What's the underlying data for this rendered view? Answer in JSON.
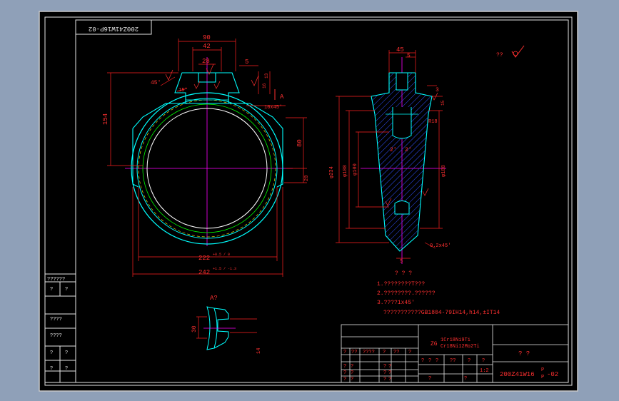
{
  "drawing": {
    "corner_code": "200Z41W16P-02",
    "code": "200Z41W16",
    "code_suffix": "-02",
    "code_p_upper": "P",
    "code_p_lower": "P",
    "roughness_note": "??",
    "section_label": "A",
    "detail_label": "A?",
    "material_line1": "ZG",
    "material_line2": "1Cr18Ni9Ti",
    "material_line3": "Cr18Ni12Mo2Ti",
    "scale": "1:2",
    "title_cell": "?   ?",
    "tech_title": "?  ?  ?",
    "notes": [
      "1.????????T???",
      "2.????????.??????",
      "3.????1x45'",
      "???????????GB1804-79IH14,h14,±IT14"
    ]
  },
  "front_dims": {
    "d90": "90",
    "d42": "42",
    "d28": "28",
    "d5": "5",
    "d154": "154",
    "d80": "80",
    "d20": "20",
    "d222": "222",
    "d222_tol": "+0.5 / 0",
    "d242": "242",
    "d242_tol": "+1.5 / -1.3",
    "ang45": "45'",
    "ang15": "15'",
    "chamfer": "10x45'",
    "d13": "13",
    "d16": "16"
  },
  "side_dims": {
    "d45": "45",
    "d5": "5",
    "d3": "3",
    "d15": "15",
    "r18": "R18",
    "dia234": "φ234",
    "dia188": "φ188",
    "dia100": "φ100",
    "dia188b": "φ188",
    "ang2": "2'",
    "chamfer2": "0.2x45'",
    "d5b": "5"
  },
  "detail_dims": {
    "d30": "30",
    "d14": "14"
  },
  "left_table": {
    "rows": [
      [
        "??????",
        ""
      ],
      [
        "?",
        "?"
      ],
      [
        "",
        ""
      ],
      [
        "????",
        ""
      ],
      [
        "",
        ""
      ],
      [
        "????",
        ""
      ],
      [
        "",
        ""
      ],
      [
        "?",
        "?"
      ],
      [
        "",
        ""
      ],
      [
        "?",
        "?"
      ]
    ]
  },
  "title_block": {
    "header_cells": [
      "?",
      "??",
      "????",
      "?",
      "??",
      "?"
    ],
    "small_rows": [
      [
        "?",
        "?",
        "?",
        "?"
      ],
      [
        "?",
        "?",
        "?",
        "?"
      ],
      [
        "?",
        "?",
        "?",
        "?"
      ]
    ],
    "attr_cells": [
      "?",
      "?",
      "?",
      "??",
      "?",
      "?"
    ]
  }
}
